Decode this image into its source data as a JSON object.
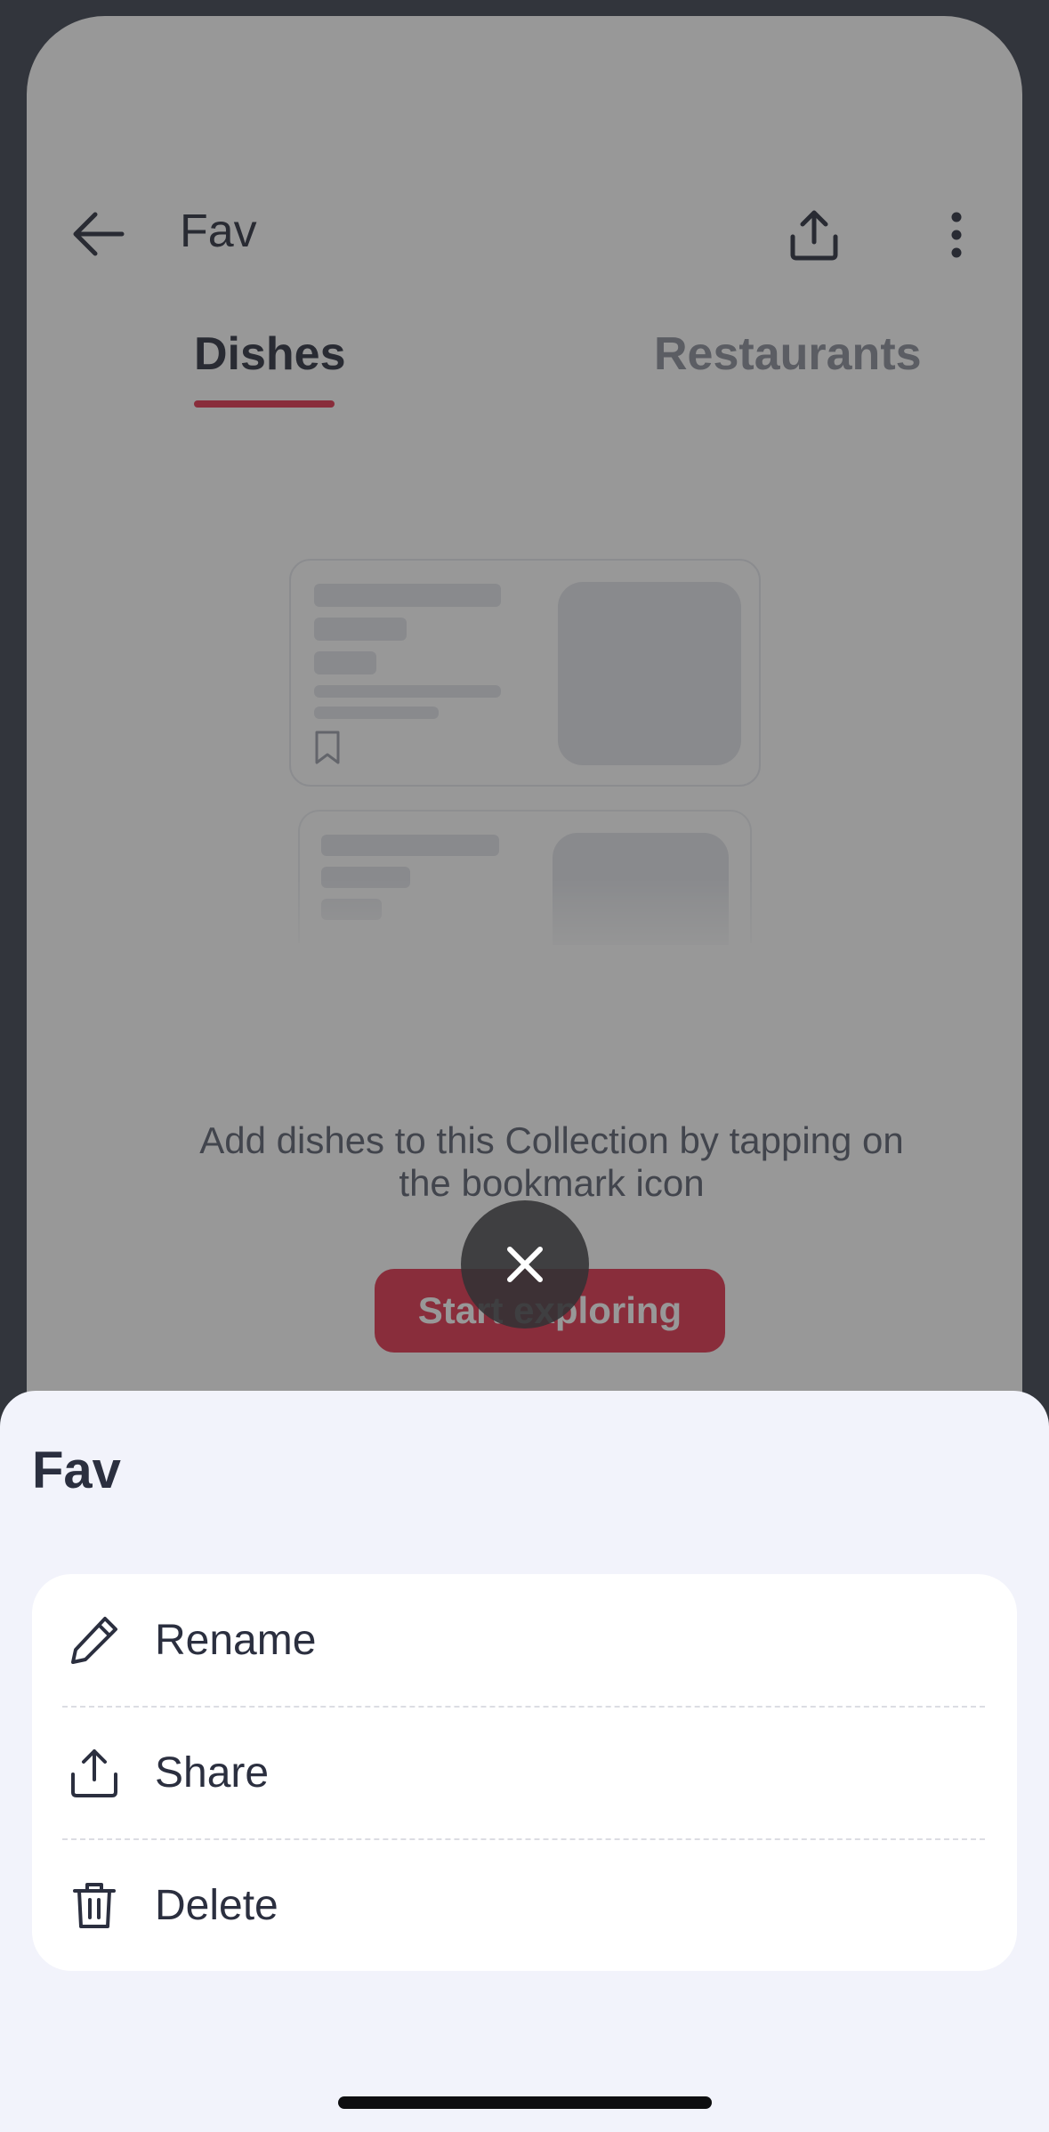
{
  "header": {
    "title": "Fav",
    "back_icon": "arrow-left-icon",
    "share_icon": "share-upload-icon",
    "more_icon": "more-vertical-icon"
  },
  "tabs": [
    {
      "label": "Dishes",
      "active": true
    },
    {
      "label": "Restaurants",
      "active": false
    }
  ],
  "empty_state": {
    "message": "Add dishes to this Collection by tapping on the bookmark icon",
    "button_label": "Start exploring"
  },
  "colors": {
    "accent": "#e2334d",
    "sheet_background": "#f2f3fb",
    "text_primary": "#2b2f3f"
  },
  "close_icon": "close-x-icon",
  "sheet": {
    "title": "Fav",
    "options": [
      {
        "label": "Rename",
        "icon": "pencil-icon"
      },
      {
        "label": "Share",
        "icon": "share-upload-icon"
      },
      {
        "label": "Delete",
        "icon": "trash-icon"
      }
    ]
  }
}
